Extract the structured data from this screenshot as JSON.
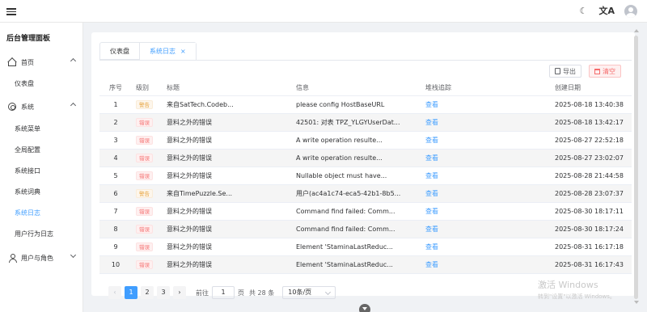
{
  "app": {
    "brand": "后台管理面板"
  },
  "sidebar": {
    "groups": [
      {
        "label": "首页",
        "items": [
          "仪表盘"
        ]
      },
      {
        "label": "系统",
        "items": [
          "系统菜单",
          "全局配置",
          "系统接口",
          "系统词典",
          "系统日志",
          "用户行为日志"
        ]
      },
      {
        "label": "用户与角色",
        "items": []
      }
    ],
    "active_item": "系统日志"
  },
  "tabs": [
    {
      "label": "仪表盘",
      "active": false
    },
    {
      "label": "系统日志",
      "active": true,
      "close": "×"
    }
  ],
  "toolbar": {
    "export_label": "导出",
    "clear_label": "清空"
  },
  "table": {
    "columns": [
      "序号",
      "级别",
      "标题",
      "信息",
      "堆栈追踪",
      "创建日期"
    ],
    "rows": [
      {
        "idx": "1",
        "level": "警告",
        "level_type": "warn",
        "title": "来自SatTech.Codeb...",
        "info": "please config HostBaseURL",
        "trace": "查看",
        "date": "2025-08-18 13:40:38"
      },
      {
        "idx": "2",
        "level": "错误",
        "level_type": "err",
        "title": "意料之外的错误",
        "info": "42501: 对表 TPZ_YLGYUserDat...",
        "trace": "查看",
        "date": "2025-08-18 13:42:17"
      },
      {
        "idx": "3",
        "level": "错误",
        "level_type": "err",
        "title": "意料之外的错误",
        "info": "A write operation resulte...",
        "trace": "查看",
        "date": "2025-08-27 22:52:18"
      },
      {
        "idx": "4",
        "level": "错误",
        "level_type": "err",
        "title": "意料之外的错误",
        "info": "A write operation resulte...",
        "trace": "查看",
        "date": "2025-08-27 23:02:07"
      },
      {
        "idx": "5",
        "level": "错误",
        "level_type": "err",
        "title": "意料之外的错误",
        "info": "Nullable object must have...",
        "trace": "查看",
        "date": "2025-08-28 21:44:58"
      },
      {
        "idx": "6",
        "level": "警告",
        "level_type": "warn",
        "title": "来自TimePuzzle.Se...",
        "info": "用户(ac4a1c74-eca5-42b1-8b5...",
        "trace": "查看",
        "date": "2025-08-28 23:07:37"
      },
      {
        "idx": "7",
        "level": "错误",
        "level_type": "err",
        "title": "意料之外的错误",
        "info": "Command find failed: Comm...",
        "trace": "查看",
        "date": "2025-08-30 18:17:11"
      },
      {
        "idx": "8",
        "level": "错误",
        "level_type": "err",
        "title": "意料之外的错误",
        "info": "Command find failed: Comm...",
        "trace": "查看",
        "date": "2025-08-30 18:17:24"
      },
      {
        "idx": "9",
        "level": "错误",
        "level_type": "err",
        "title": "意料之外的错误",
        "info": "Element 'StaminaLastReduc...",
        "trace": "查看",
        "date": "2025-08-31 16:17:18"
      },
      {
        "idx": "10",
        "level": "错误",
        "level_type": "err",
        "title": "意料之外的错误",
        "info": "Element 'StaminaLastReduc...",
        "trace": "查看",
        "date": "2025-08-31 16:17:43"
      }
    ]
  },
  "pagination": {
    "pages": [
      "1",
      "2",
      "3"
    ],
    "current": "1",
    "prev": "‹",
    "next": "›",
    "goto_label": "前往",
    "goto_value": "1",
    "page_unit": "页",
    "total": "共 28 条",
    "page_size": "10条/页"
  },
  "watermark": {
    "line1": "激活 Windows",
    "line2": "转到\"设置\"以激活 Windows。"
  },
  "colors": {
    "primary": "#409eff",
    "danger": "#f56c6c",
    "warning": "#e6a23c",
    "background": "#f0f2f5"
  }
}
